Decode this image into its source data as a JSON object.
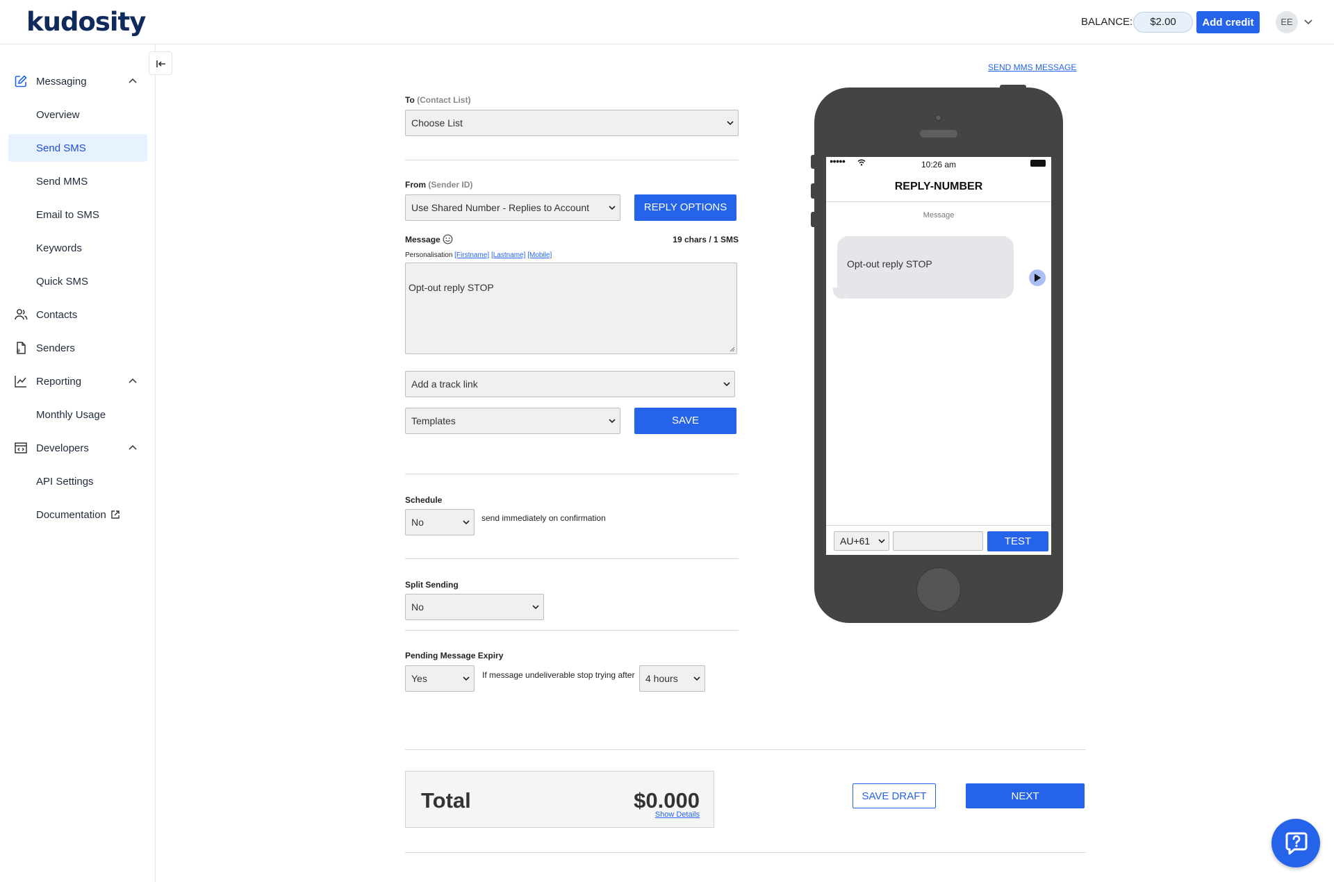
{
  "header": {
    "logo": "kudosity",
    "balance_label": "BALANCE:",
    "balance_value": "$2.00",
    "add_credit": "Add credit",
    "avatar": "EE"
  },
  "sidebar": {
    "messaging": "Messaging",
    "overview": "Overview",
    "send_sms": "Send SMS",
    "send_mms": "Send MMS",
    "email_to_sms": "Email to SMS",
    "keywords": "Keywords",
    "quick_sms": "Quick SMS",
    "contacts": "Contacts",
    "senders": "Senders",
    "reporting": "Reporting",
    "monthly_usage": "Monthly Usage",
    "developers": "Developers",
    "api_settings": "API Settings",
    "documentation": "Documentation"
  },
  "form": {
    "to_label": "To",
    "to_sub": "(Contact List)",
    "to_value": "Choose List",
    "from_label": "From",
    "from_sub": "(Sender ID)",
    "from_value": "Use Shared Number - Replies to Account",
    "reply_options": "REPLY OPTIONS",
    "message_label": "Message",
    "char_count": "19 chars / 1 SMS",
    "personalisation_label": "Personalisation",
    "tag_firstname": "[Firstname]",
    "tag_lastname": "[Lastname]",
    "tag_mobile": "[Mobile]",
    "message_text": "Opt-out reply STOP",
    "track_link": "Add a track link",
    "templates": "Templates",
    "save": "SAVE",
    "schedule_label": "Schedule",
    "schedule_value": "No",
    "schedule_note": "send immediately on confirmation",
    "split_label": "Split Sending",
    "split_value": "No",
    "expiry_label": "Pending Message Expiry",
    "expiry_value": "Yes",
    "expiry_note": "If message undeliverable stop trying after",
    "expiry_hours": "4 hours"
  },
  "preview": {
    "send_mms_link": "SEND MMS MESSAGE",
    "time": "10:26 am",
    "title": "REPLY-NUMBER",
    "message_label": "Message",
    "bubble_text": "Opt-out reply STOP",
    "country_code": "AU+61",
    "test_button": "TEST"
  },
  "footer": {
    "total_label": "Total",
    "total_value": "$0.000",
    "show_details": "Show Details",
    "save_draft": "SAVE DRAFT",
    "next": "NEXT"
  },
  "colors": {
    "accent": "#2563eb",
    "active_nav_bg": "#e8f1fe",
    "phone_body": "#444444"
  }
}
